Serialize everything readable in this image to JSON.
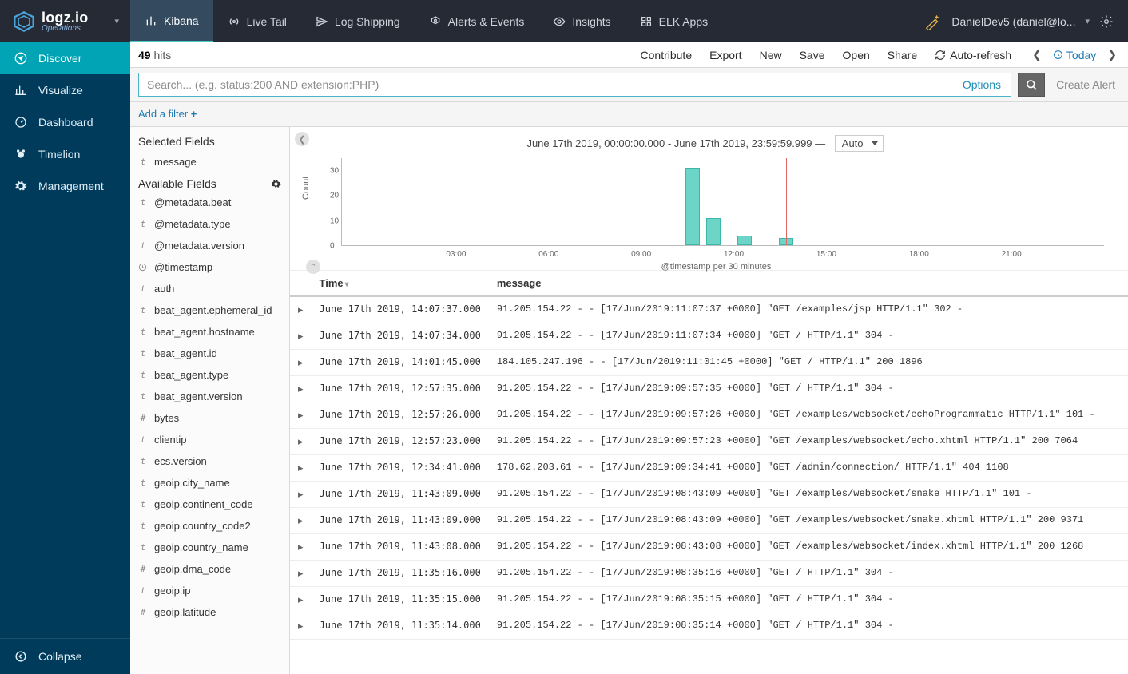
{
  "brand": {
    "name": "logz.io",
    "sub": "Operations"
  },
  "topnav": [
    {
      "label": "Kibana",
      "icon": "bars"
    },
    {
      "label": "Live Tail",
      "icon": "broadcast"
    },
    {
      "label": "Log Shipping",
      "icon": "send"
    },
    {
      "label": "Alerts & Events",
      "icon": "bell"
    },
    {
      "label": "Insights",
      "icon": "eye"
    },
    {
      "label": "ELK Apps",
      "icon": "grid"
    }
  ],
  "user": {
    "label": "DanielDev5 (daniel@lo..."
  },
  "sidebar": [
    {
      "label": "Discover",
      "icon": "compass",
      "active": true
    },
    {
      "label": "Visualize",
      "icon": "chart"
    },
    {
      "label": "Dashboard",
      "icon": "dashboard"
    },
    {
      "label": "Timelion",
      "icon": "timelion"
    },
    {
      "label": "Management",
      "icon": "gear"
    }
  ],
  "collapse_label": "Collapse",
  "hits": {
    "count": "49",
    "label": "hits"
  },
  "toolbar": {
    "contribute": "Contribute",
    "export": "Export",
    "new": "New",
    "save": "Save",
    "open": "Open",
    "share": "Share",
    "auto_refresh": "Auto-refresh",
    "today": "Today"
  },
  "search": {
    "placeholder": "Search... (e.g. status:200 AND extension:PHP)",
    "options": "Options"
  },
  "create_alert": "Create Alert",
  "add_filter": "Add a filter",
  "fields": {
    "selected_label": "Selected Fields",
    "available_label": "Available Fields",
    "selected": [
      {
        "type": "t",
        "name": "message"
      }
    ],
    "available": [
      {
        "type": "t",
        "name": "@metadata.beat"
      },
      {
        "type": "t",
        "name": "@metadata.type"
      },
      {
        "type": "t",
        "name": "@metadata.version"
      },
      {
        "type": "clock",
        "name": "@timestamp"
      },
      {
        "type": "t",
        "name": "auth"
      },
      {
        "type": "t",
        "name": "beat_agent.ephemeral_id"
      },
      {
        "type": "t",
        "name": "beat_agent.hostname"
      },
      {
        "type": "t",
        "name": "beat_agent.id"
      },
      {
        "type": "t",
        "name": "beat_agent.type"
      },
      {
        "type": "t",
        "name": "beat_agent.version"
      },
      {
        "type": "#",
        "name": "bytes"
      },
      {
        "type": "t",
        "name": "clientip"
      },
      {
        "type": "t",
        "name": "ecs.version"
      },
      {
        "type": "t",
        "name": "geoip.city_name"
      },
      {
        "type": "t",
        "name": "geoip.continent_code"
      },
      {
        "type": "t",
        "name": "geoip.country_code2"
      },
      {
        "type": "t",
        "name": "geoip.country_name"
      },
      {
        "type": "#",
        "name": "geoip.dma_code"
      },
      {
        "type": "t",
        "name": "geoip.ip"
      },
      {
        "type": "#",
        "name": "geoip.latitude"
      }
    ]
  },
  "histogram": {
    "range_label": "June 17th 2019, 00:00:00.000 - June 17th 2019, 23:59:59.999 —",
    "interval": "Auto",
    "ylabel": "Count",
    "xlabel": "@timestamp per 30 minutes"
  },
  "chart_data": {
    "type": "bar",
    "xlabel": "@timestamp per 30 minutes",
    "ylabel": "Count",
    "ylim": [
      0,
      35
    ],
    "yticks": [
      0,
      10,
      20,
      30
    ],
    "x_ticks": [
      "03:00",
      "06:00",
      "09:00",
      "12:00",
      "15:00",
      "18:00",
      "21:00"
    ],
    "x_tick_positions_pct": [
      12.5,
      25,
      37.5,
      50,
      62.5,
      75,
      87.5
    ],
    "now_line_pct": 58.3,
    "bars": [
      {
        "x_pct": 46.0,
        "value": 31
      },
      {
        "x_pct": 48.7,
        "value": 11
      },
      {
        "x_pct": 52.8,
        "value": 4
      },
      {
        "x_pct": 58.3,
        "value": 3
      }
    ]
  },
  "table": {
    "cols": [
      "Time",
      "message"
    ],
    "rows": [
      {
        "time": "June 17th 2019, 14:07:37.000",
        "msg": "91.205.154.22 - - [17/Jun/2019:11:07:37 +0000] \"GET /examples/jsp HTTP/1.1\" 302 -"
      },
      {
        "time": "June 17th 2019, 14:07:34.000",
        "msg": "91.205.154.22 - - [17/Jun/2019:11:07:34 +0000] \"GET / HTTP/1.1\" 304 -"
      },
      {
        "time": "June 17th 2019, 14:01:45.000",
        "msg": "184.105.247.196 - - [17/Jun/2019:11:01:45 +0000] \"GET / HTTP/1.1\" 200 1896"
      },
      {
        "time": "June 17th 2019, 12:57:35.000",
        "msg": "91.205.154.22 - - [17/Jun/2019:09:57:35 +0000] \"GET / HTTP/1.1\" 304 -"
      },
      {
        "time": "June 17th 2019, 12:57:26.000",
        "msg": "91.205.154.22 - - [17/Jun/2019:09:57:26 +0000] \"GET /examples/websocket/echoProgrammatic HTTP/1.1\" 101 -"
      },
      {
        "time": "June 17th 2019, 12:57:23.000",
        "msg": "91.205.154.22 - - [17/Jun/2019:09:57:23 +0000] \"GET /examples/websocket/echo.xhtml HTTP/1.1\" 200 7064"
      },
      {
        "time": "June 17th 2019, 12:34:41.000",
        "msg": "178.62.203.61 - - [17/Jun/2019:09:34:41 +0000] \"GET /admin/connection/ HTTP/1.1\" 404 1108"
      },
      {
        "time": "June 17th 2019, 11:43:09.000",
        "msg": "91.205.154.22 - - [17/Jun/2019:08:43:09 +0000] \"GET /examples/websocket/snake HTTP/1.1\" 101 -"
      },
      {
        "time": "June 17th 2019, 11:43:09.000",
        "msg": "91.205.154.22 - - [17/Jun/2019:08:43:09 +0000] \"GET /examples/websocket/snake.xhtml HTTP/1.1\" 200 9371"
      },
      {
        "time": "June 17th 2019, 11:43:08.000",
        "msg": "91.205.154.22 - - [17/Jun/2019:08:43:08 +0000] \"GET /examples/websocket/index.xhtml HTTP/1.1\" 200 1268"
      },
      {
        "time": "June 17th 2019, 11:35:16.000",
        "msg": "91.205.154.22 - - [17/Jun/2019:08:35:16 +0000] \"GET / HTTP/1.1\" 304 -"
      },
      {
        "time": "June 17th 2019, 11:35:15.000",
        "msg": "91.205.154.22 - - [17/Jun/2019:08:35:15 +0000] \"GET / HTTP/1.1\" 304 -"
      },
      {
        "time": "June 17th 2019, 11:35:14.000",
        "msg": "91.205.154.22 - - [17/Jun/2019:08:35:14 +0000] \"GET / HTTP/1.1\" 304 -"
      }
    ]
  }
}
